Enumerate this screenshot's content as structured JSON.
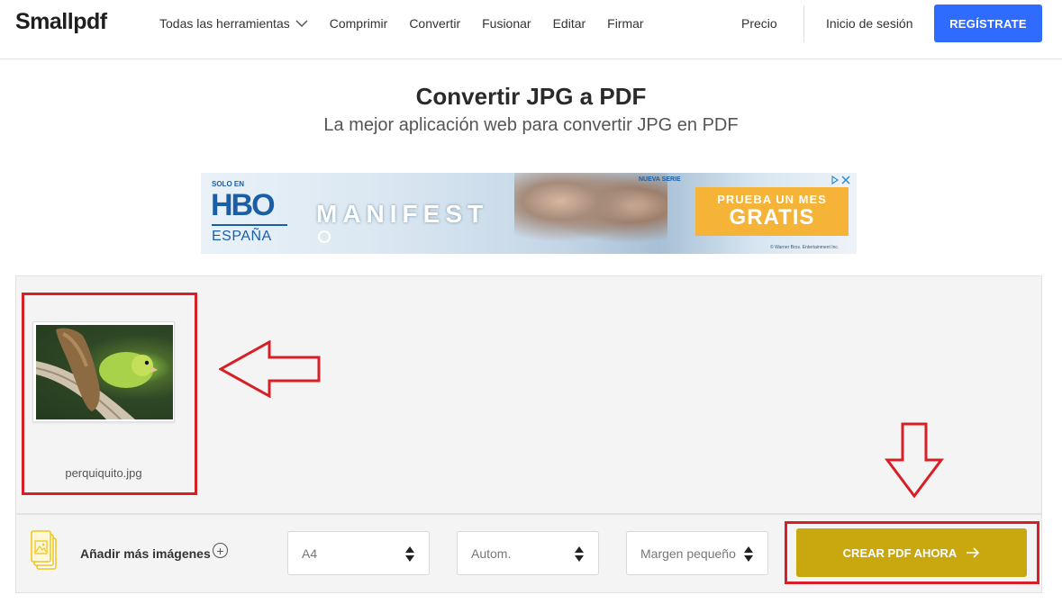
{
  "header": {
    "logo": "Smallpdf",
    "nav": [
      {
        "label": "Todas las herramientas"
      },
      {
        "label": "Comprimir"
      },
      {
        "label": "Convertir"
      },
      {
        "label": "Fusionar"
      },
      {
        "label": "Editar"
      },
      {
        "label": "Firmar"
      }
    ],
    "pricing": "Precio",
    "login": "Inicio de sesión",
    "signup": "REGÍSTRATE"
  },
  "page": {
    "title": "Convertir JPG a PDF",
    "subtitle": "La mejor aplicación web para convertir JPG en PDF"
  },
  "ad": {
    "solo_en": "SOLO EN",
    "hbo": "HBO",
    "espana": "ESPAÑA",
    "show": "MANIFEST",
    "nueva_serie": "NUEVA SERIE",
    "cta_line1": "PRUEBA UN MES",
    "cta_line2": "GRATIS",
    "legal": "© Warner Bros. Entertainment Inc."
  },
  "files": [
    {
      "name": "perquiquito.jpg"
    }
  ],
  "toolbar": {
    "add_more": "Añadir más imágenes",
    "page_size": "A4",
    "orientation": "Autom.",
    "margin": "Margen pequeño",
    "create": "CREAR PDF AHORA"
  },
  "colors": {
    "accent_blue": "#2f6bff",
    "create_button": "#c8a80e",
    "annotation_red": "#d61f26"
  }
}
